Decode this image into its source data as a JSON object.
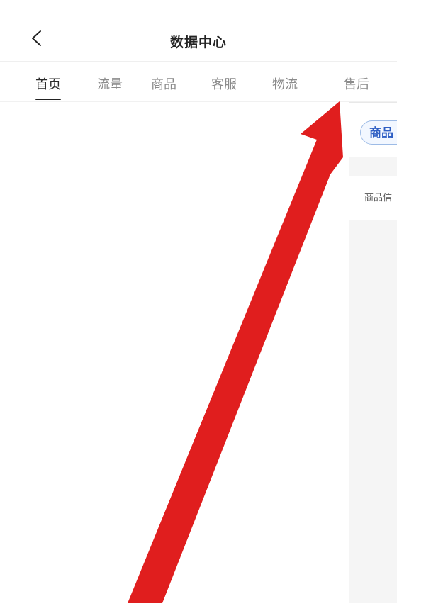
{
  "header": {
    "title": "数据中心",
    "back_icon": "chevron-left-icon"
  },
  "tabs": [
    {
      "label": "首页",
      "active": true
    },
    {
      "label": "流量",
      "active": false
    },
    {
      "label": "商品",
      "active": false
    },
    {
      "label": "客服",
      "active": false
    },
    {
      "label": "物流",
      "active": false
    },
    {
      "label": "售后",
      "active": false
    }
  ],
  "right_panel": {
    "chip_label": "商品",
    "info_label": "商品信"
  },
  "annotation": {
    "arrow_color": "#e01e1e",
    "icon": "red-arrow-icon"
  },
  "colors": {
    "background": "#ffffff",
    "chip_border": "#9dbbe6",
    "chip_text": "#2f5fc4",
    "panel_background": "#f5f5f5"
  }
}
